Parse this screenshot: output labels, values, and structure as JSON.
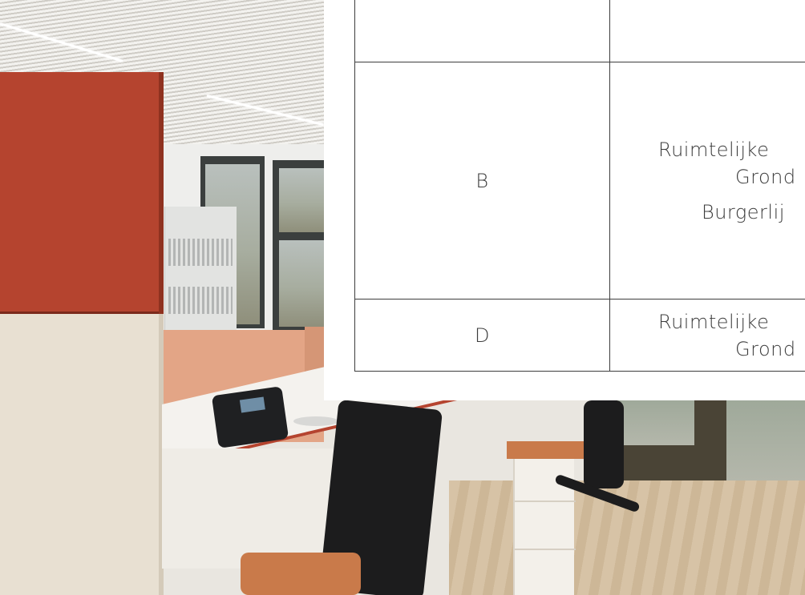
{
  "table": {
    "rows": [
      {
        "code": "",
        "lines": []
      },
      {
        "code": "B",
        "lines": [
          "Ruimtelijke",
          "Grond",
          "Burgerlij"
        ]
      },
      {
        "code": "D",
        "lines": [
          "Ruimtelijke",
          "Grond"
        ]
      }
    ]
  },
  "colors": {
    "accent_red": "#b5442f",
    "divider_orange": "#e3a586",
    "table_border": "#3d3d3d",
    "text": "#3c3c3c"
  }
}
